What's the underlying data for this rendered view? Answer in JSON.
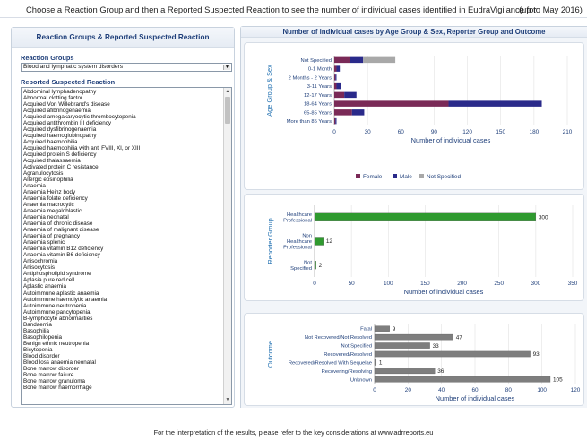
{
  "header": {
    "instruction": "Choose a Reaction Group and then a Reported Suspected Reaction to see the number of individual cases identified in EudraVigilance for",
    "period": "(up to May 2016)"
  },
  "left_panel": {
    "title": "Reaction Groups & Reported Suspected Reaction",
    "groups_label": "Reaction Groups",
    "selected_group": "Blood and lymphatic system disorders",
    "reactions_label": "Reported Suspected Reaction",
    "reactions": [
      "Abdominal lymphadenopathy",
      "Abnormal clotting factor",
      "Acquired Von Willebrand's disease",
      "Acquired afibrinogenaemia",
      "Acquired amegakaryocytic thrombocytopenia",
      "Acquired antithrombin III deficiency",
      "Acquired dysfibrinogenaemia",
      "Acquired haemoglobinopathy",
      "Acquired haemophilia",
      "Acquired haemophilia with anti FVIII, XI, or XIII",
      "Acquired protein S deficiency",
      "Acquired thalassaemia",
      "Activated protein C resistance",
      "Agranulocytosis",
      "Allergic eosinophilia",
      "Anaemia",
      "Anaemia Heinz body",
      "Anaemia folate deficiency",
      "Anaemia macrocytic",
      "Anaemia megaloblastic",
      "Anaemia neonatal",
      "Anaemia of chronic disease",
      "Anaemia of malignant disease",
      "Anaemia of pregnancy",
      "Anaemia splenic",
      "Anaemia vitamin B12 deficiency",
      "Anaemia vitamin B6 deficiency",
      "Anisochromia",
      "Anisocytosis",
      "Antiphospholipid syndrome",
      "Aplasia pure red cell",
      "Aplastic anaemia",
      "Autoimmune aplastic anaemia",
      "Autoimmune haemolytic anaemia",
      "Autoimmune neutropenia",
      "Autoimmune pancytopenia",
      "B-lymphocyte abnormalities",
      "Bandaemia",
      "Basophilia",
      "Basophilopenia",
      "Benign ethnic neutropenia",
      "Bicytopenia",
      "Blood disorder",
      "Blood loss anaemia neonatal",
      "Bone marrow disorder",
      "Bone marrow failure",
      "Bone marrow granuloma",
      "Bone marrow haemorrhage"
    ]
  },
  "right_panel": {
    "title": "Number of individual cases by Age Group & Sex, Reporter Group and Outcome"
  },
  "charts": {
    "age": {
      "ylabel": "Age Group & Sex",
      "xlabel": "Number of individual cases",
      "legend": [
        "Female",
        "Male",
        "Not Specified"
      ],
      "colors": [
        "#7a2a57",
        "#2a2a8a",
        "#a8a8a8"
      ],
      "xlim": [
        0,
        210
      ],
      "ticks": [
        "0",
        "30",
        "60",
        "90",
        "120",
        "150",
        "180",
        "210"
      ]
    },
    "reporter": {
      "ylabel": "Reporter Group",
      "xlabel": "Number of individual cases",
      "color": "#2f9a2f",
      "xlim": [
        0,
        350
      ],
      "ticks": [
        "0",
        "50",
        "100",
        "150",
        "200",
        "250",
        "300",
        "350"
      ]
    },
    "outcome": {
      "ylabel": "Outcome",
      "xlabel": "Number of individual cases",
      "color": "#7e7e7e",
      "xlim": [
        0,
        120
      ],
      "ticks": [
        "0",
        "20",
        "40",
        "60",
        "80",
        "100",
        "120"
      ]
    }
  },
  "chart_data": [
    {
      "type": "bar",
      "orientation": "horizontal",
      "stacked": true,
      "categories": [
        "Not Specified",
        "0-1 Month",
        "2 Months - 2 Years",
        "3-11 Years",
        "12-17 Years",
        "18-64 Years",
        "65-85 Years",
        "More than 85 Years"
      ],
      "series": [
        {
          "name": "Female",
          "values": [
            14,
            2,
            1,
            2,
            9,
            103,
            16,
            1
          ]
        },
        {
          "name": "Male",
          "values": [
            12,
            3,
            1,
            4,
            11,
            84,
            11,
            1
          ]
        },
        {
          "name": "Not Specified",
          "values": [
            29,
            0,
            0,
            0,
            0,
            0,
            0,
            0
          ]
        }
      ],
      "xlabel": "Number of individual cases",
      "ylabel": "Age Group & Sex",
      "xlim": [
        0,
        210
      ],
      "legend": "bottom"
    },
    {
      "type": "bar",
      "orientation": "horizontal",
      "categories": [
        "Healthcare Professional",
        "Non Healthcare Professional",
        "Not Specified"
      ],
      "values": [
        300,
        12,
        2
      ],
      "xlabel": "Number of individual cases",
      "ylabel": "Reporter Group",
      "xlim": [
        0,
        350
      ]
    },
    {
      "type": "bar",
      "orientation": "horizontal",
      "categories": [
        "Fatal",
        "Not Recovered/Not Resolved",
        "Not Specified",
        "Recovered/Resolved",
        "Recovered/Resolved With Sequelae",
        "Recovering/Resolving",
        "Unknown"
      ],
      "values": [
        9,
        47,
        33,
        93,
        1,
        36,
        105
      ],
      "xlabel": "Number of individual cases",
      "ylabel": "Outcome",
      "xlim": [
        0,
        120
      ]
    }
  ],
  "footer": {
    "text": "For the interpretation of the results, please refer to the key considerations at www.adrreports.eu"
  }
}
